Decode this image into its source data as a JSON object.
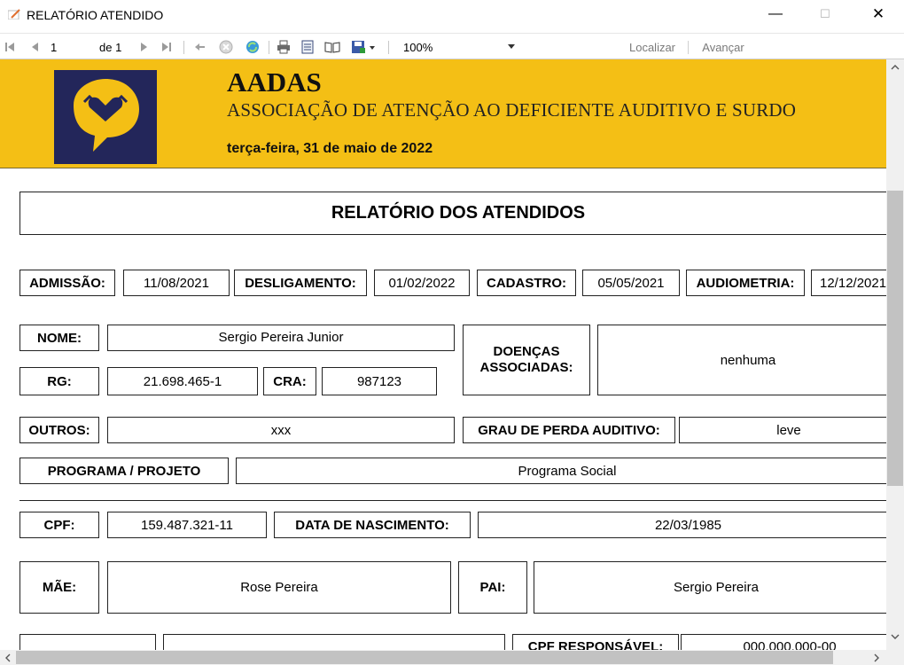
{
  "window": {
    "title": "RELATÓRIO ATENDIDO",
    "minimize": "—",
    "maximize": "☐",
    "close": "✕"
  },
  "toolbar": {
    "page_current": "1",
    "page_of": "de 1",
    "zoom": "100%",
    "find": "Localizar",
    "next": "Avançar"
  },
  "header": {
    "org_short": "AADAS",
    "org_full": "ASSOCIAÇÃO DE ATENÇÃO AO DEFICIENTE AUDITIVO E SURDO",
    "date": "terça-feira, 31 de maio de 2022"
  },
  "report": {
    "title": "RELATÓRIO DOS ATENDIDOS",
    "admissao_label": "ADMISSÃO:",
    "admissao": "11/08/2021",
    "desligamento_label": "DESLIGAMENTO:",
    "desligamento": "01/02/2022",
    "cadastro_label": "CADASTRO:",
    "cadastro": "05/05/2021",
    "audiometria_label": "AUDIOMETRIA:",
    "audiometria": "12/12/2021",
    "nome_label": "NOME:",
    "nome": "Sergio Pereira Junior",
    "doencas_label": "DOENÇAS ASSOCIADAS:",
    "doencas": "nenhuma",
    "rg_label": "RG:",
    "rg": "21.698.465-1",
    "cra_label": "CRA:",
    "cra": "987123",
    "outros_label": "OUTROS:",
    "outros": "xxx",
    "grau_label": "GRAU DE PERDA AUDITIVO:",
    "grau": "leve",
    "programa_label": "PROGRAMA / PROJETO",
    "programa": "Programa Social",
    "cpf_label": "CPF:",
    "cpf": "159.487.321-11",
    "nascimento_label": "DATA DE NASCIMENTO:",
    "nascimento": "22/03/1985",
    "mae_label": "MÃE:",
    "mae": "Rose Pereira",
    "pai_label": "PAI:",
    "pai": "Sergio Pereira",
    "cpf_resp_label": "CPF RESPONSÁVEL:",
    "cpf_resp": "000.000.000-00"
  },
  "colors": {
    "banner": "#f4bf15",
    "logo_bg": "#23265a"
  }
}
